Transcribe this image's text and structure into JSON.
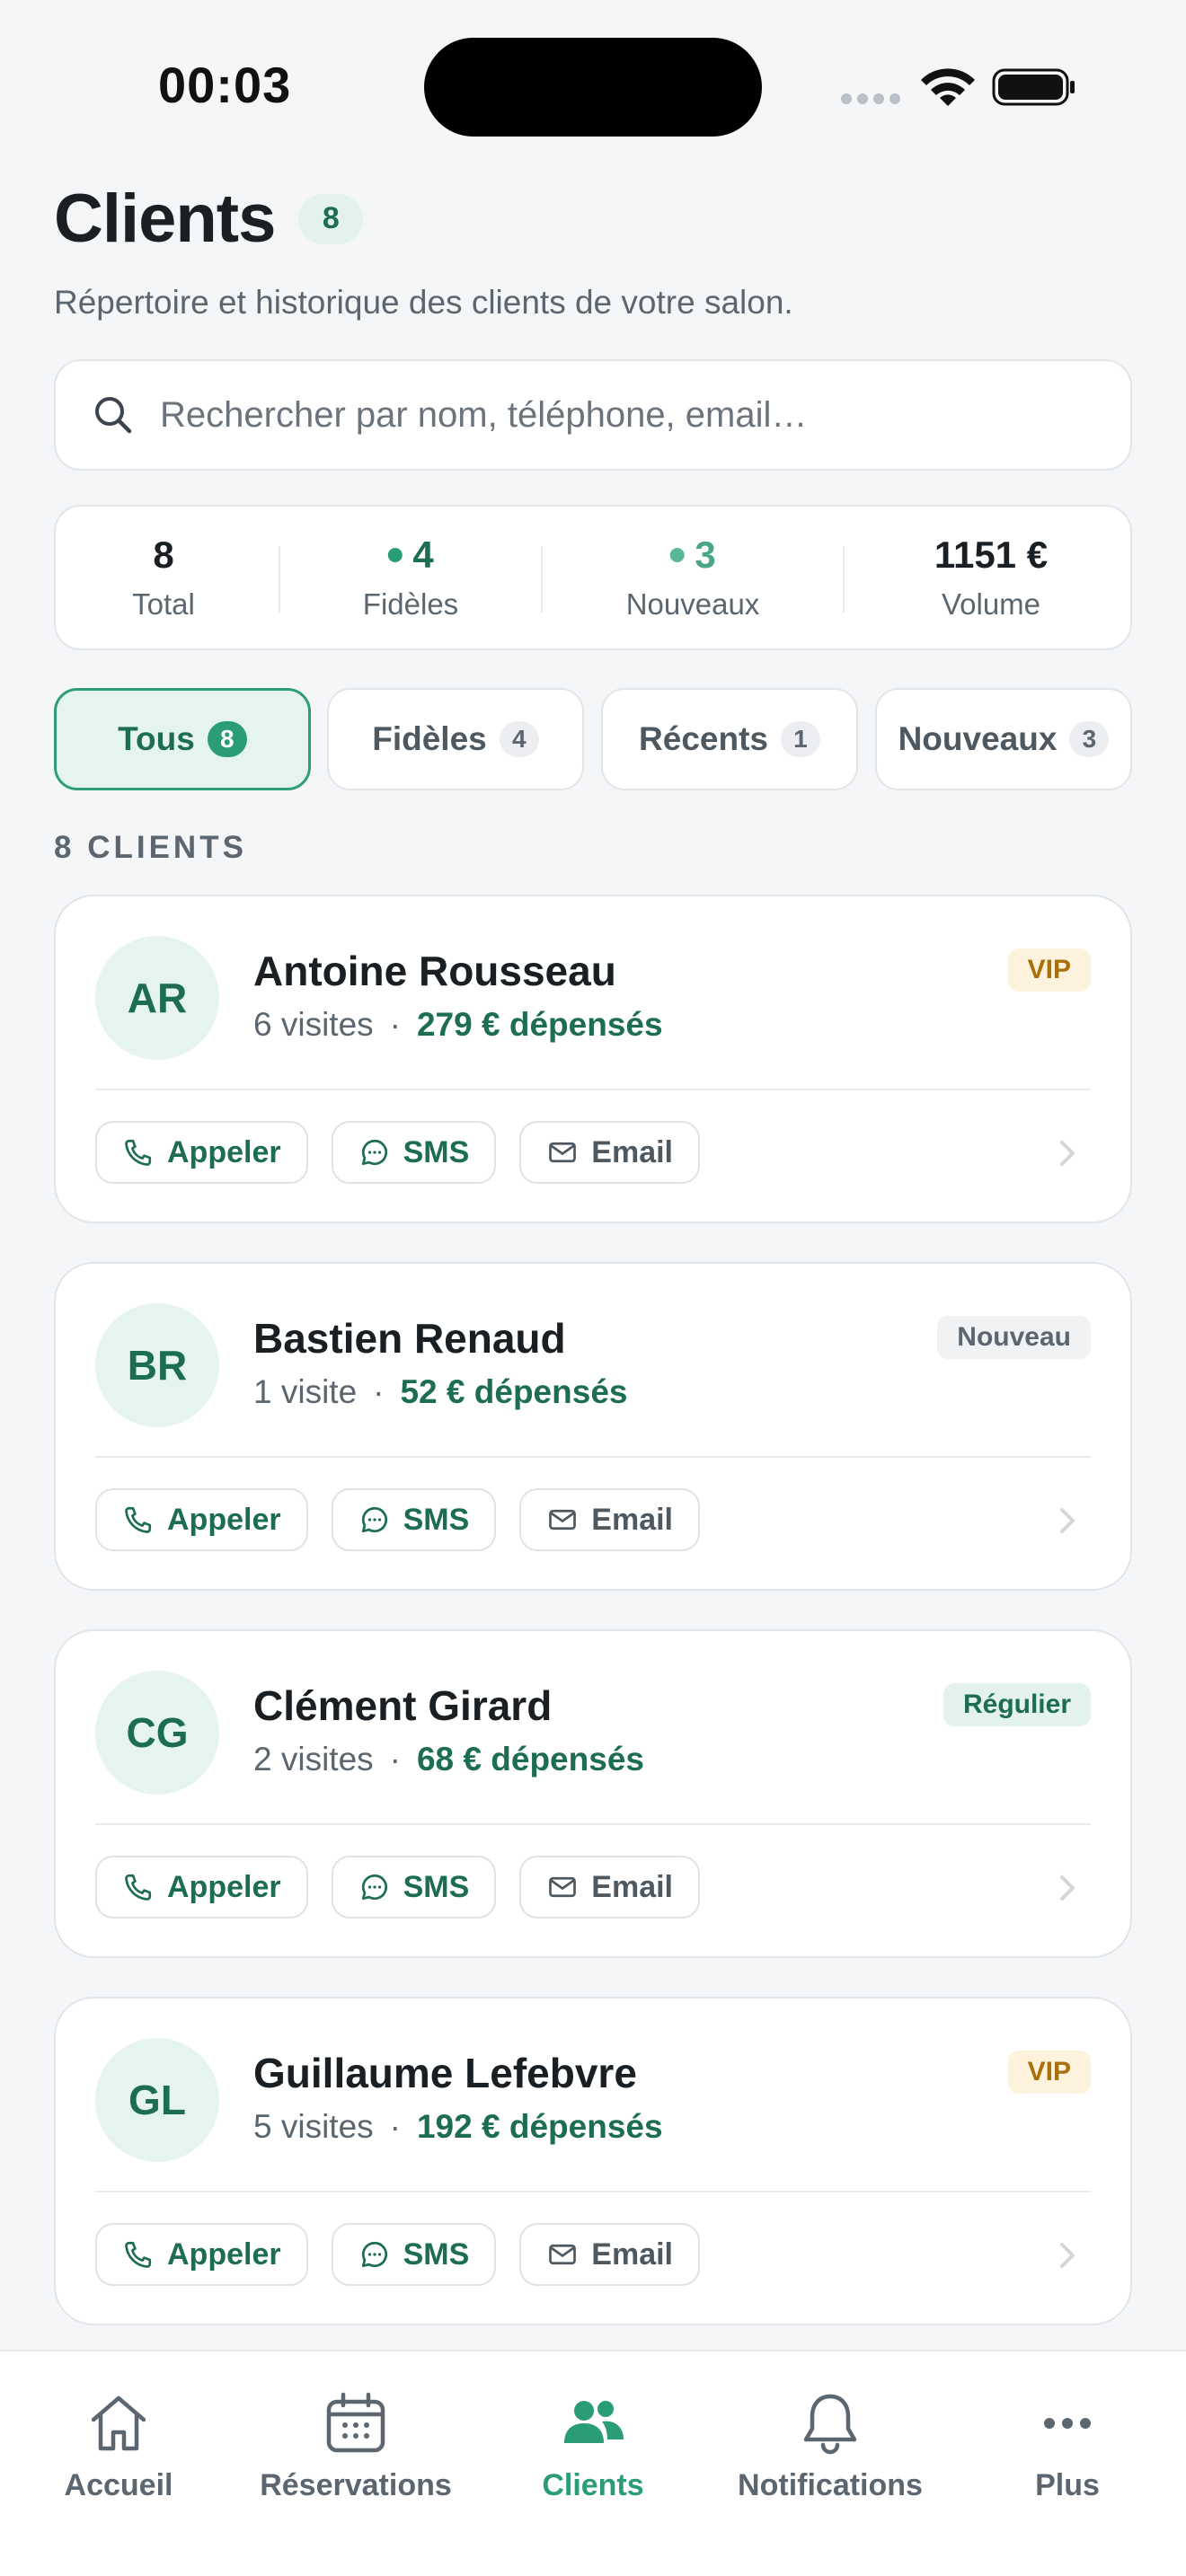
{
  "status_bar": {
    "time": "00:03"
  },
  "header": {
    "title": "Clients",
    "count": "8",
    "subtitle": "Répertoire et historique des clients de votre salon."
  },
  "search": {
    "placeholder": "Rechercher par nom, téléphone, email…"
  },
  "stats": [
    {
      "value": "8",
      "label": "Total"
    },
    {
      "value": "4",
      "label": "Fidèles"
    },
    {
      "value": "3",
      "label": "Nouveaux"
    },
    {
      "value": "1151 €",
      "label": "Volume"
    }
  ],
  "filters": [
    {
      "label": "Tous",
      "count": "8",
      "active": true
    },
    {
      "label": "Fidèles",
      "count": "4"
    },
    {
      "label": "Récents",
      "count": "1"
    },
    {
      "label": "Nouveaux",
      "count": "3"
    }
  ],
  "list": {
    "section_label": "8 CLIENTS",
    "clients": [
      {
        "initials": "AR",
        "name": "Antoine Rousseau",
        "visits": "6 visites",
        "separator": "·",
        "spent": "279 € dépensés",
        "badge": "VIP",
        "badge_type": "vip"
      },
      {
        "initials": "BR",
        "name": "Bastien Renaud",
        "visits": "1 visite",
        "separator": "·",
        "spent": "52 € dépensés",
        "badge": "Nouveau",
        "badge_type": "new"
      },
      {
        "initials": "CG",
        "name": "Clément Girard",
        "visits": "2 visites",
        "separator": "·",
        "spent": "68 € dépensés",
        "badge": "Régulier",
        "badge_type": "regular"
      },
      {
        "initials": "GL",
        "name": "Guillaume Lefebvre",
        "visits": "5 visites",
        "separator": "·",
        "spent": "192 € dépensés",
        "badge": "VIP",
        "badge_type": "vip"
      }
    ],
    "actions": {
      "call": "Appeler",
      "sms": "SMS",
      "email": "Email"
    }
  },
  "tabbar": [
    {
      "label": "Accueil",
      "icon": "home-icon"
    },
    {
      "label": "Réservations",
      "icon": "calendar-icon"
    },
    {
      "label": "Clients",
      "icon": "users-icon",
      "active": true
    },
    {
      "label": "Notifications",
      "icon": "bell-icon"
    },
    {
      "label": "Plus",
      "icon": "more-icon"
    }
  ],
  "colors": {
    "accent": "#2a9d78",
    "accent_dark": "#1d6d50",
    "vip": "#a8700b",
    "background": "#f5f6f8"
  }
}
